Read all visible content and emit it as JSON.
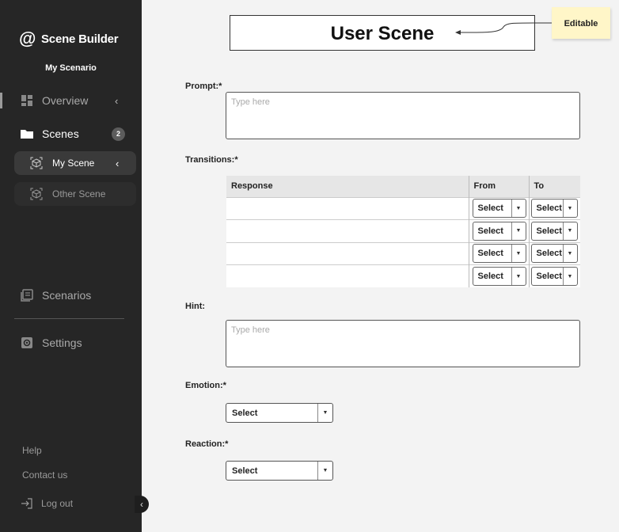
{
  "sidebar": {
    "brand": {
      "at_symbol": "@",
      "name": "Scene Builder"
    },
    "scenario_name": "My Scenario",
    "items": [
      {
        "label": "Overview",
        "icon": "dashboard-icon",
        "chevron": "‹"
      },
      {
        "label": "Scenes",
        "icon": "folder-icon",
        "badge": "2"
      },
      {
        "label": "Scenarios",
        "icon": "library-icon"
      },
      {
        "label": "Settings",
        "icon": "gear-icon"
      }
    ],
    "scenes": [
      {
        "label": "My Scene",
        "icon": "cube-icon",
        "chevron": "‹"
      },
      {
        "label": "Other Scene",
        "icon": "cube-icon"
      }
    ],
    "footer": {
      "help": "Help",
      "contact": "Contact us",
      "logout": "Log out"
    },
    "collapse_icon": "‹"
  },
  "main": {
    "title": "User Scene",
    "note": "Editable",
    "prompt": {
      "label": "Prompt:*",
      "placeholder": "Type here"
    },
    "transitions": {
      "label": "Transitions:*",
      "headers": {
        "response": "Response",
        "from": "From",
        "to": "To"
      },
      "rows": [
        {
          "from": "Select",
          "to": "Select"
        },
        {
          "from": "Select",
          "to": "Select"
        },
        {
          "from": "Select",
          "to": "Select"
        },
        {
          "from": "Select",
          "to": "Select"
        }
      ]
    },
    "hint": {
      "label": "Hint:",
      "placeholder": "Type here"
    },
    "emotion": {
      "label": "Emotion:*",
      "value": "Select"
    },
    "reaction": {
      "label": "Reaction:*",
      "value": "Select"
    },
    "dropdown_glyph": "▼"
  },
  "colors": {
    "sidebar_bg": "#262626",
    "page_bg": "#f3f3f3",
    "note_bg": "#fff6c8"
  }
}
